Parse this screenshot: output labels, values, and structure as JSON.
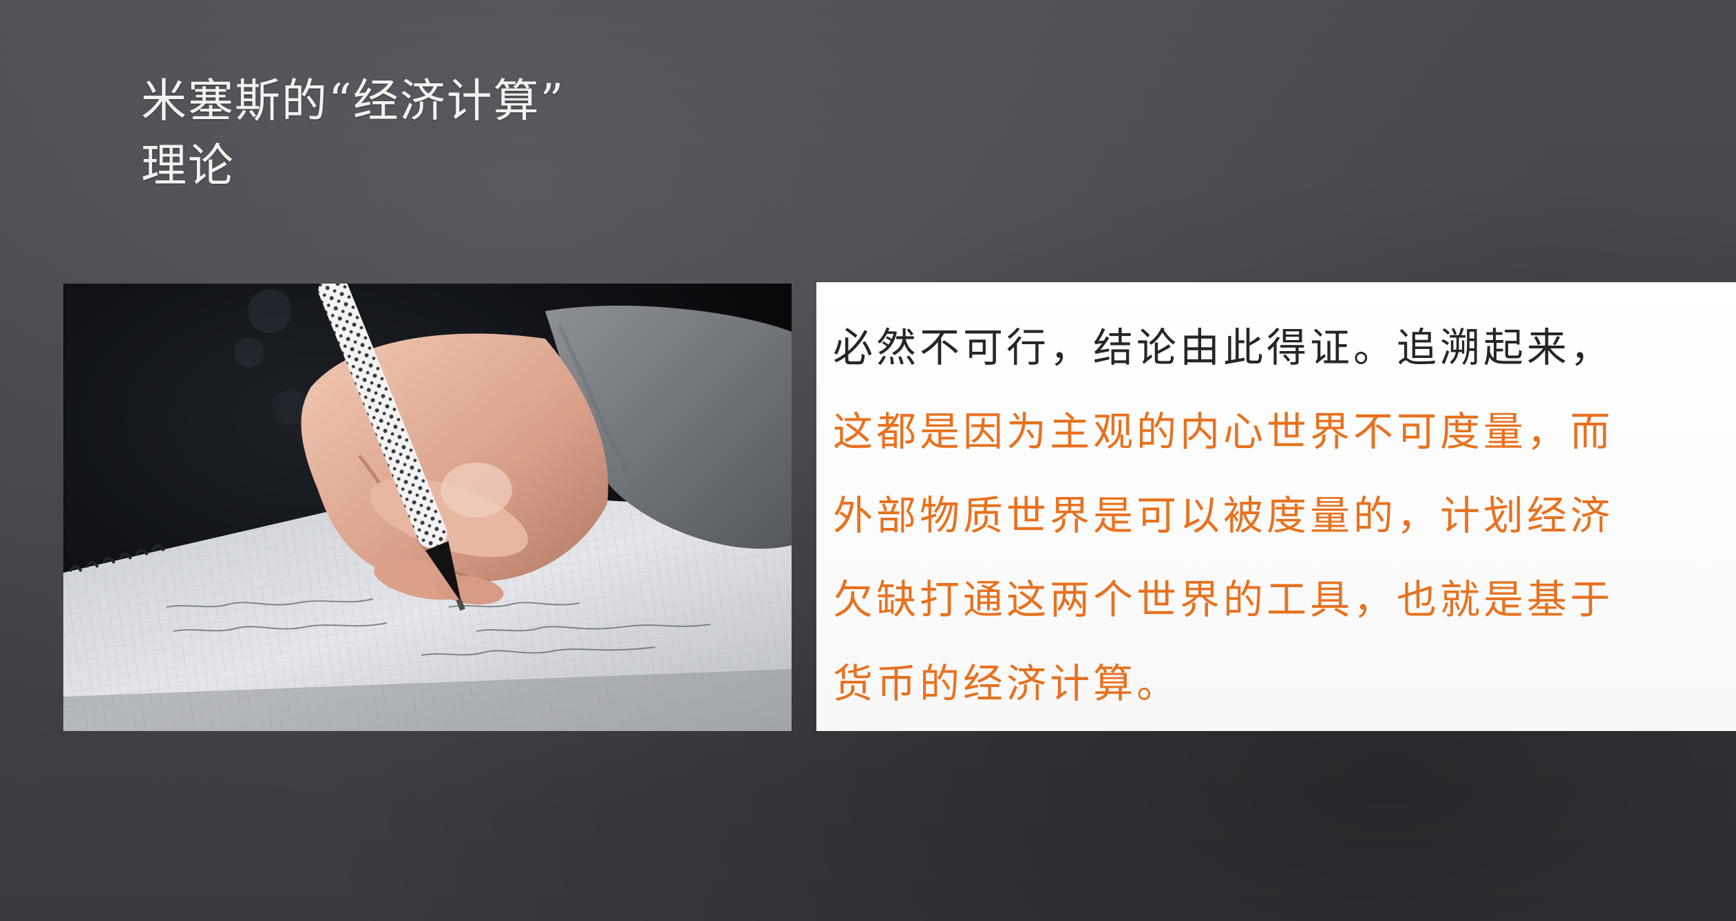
{
  "slide": {
    "title_line1": "米塞斯的“经济计算”",
    "title_line2": "理论"
  },
  "photo": {
    "subject": "hand-writing-with-pen-on-notebook"
  },
  "card": {
    "lines": [
      {
        "text": "必然不可行，结论由此得证。追溯起来，",
        "color": "#262626"
      },
      {
        "text": "这都是因为主观的内心世界不可度量，而",
        "color": "#e8711f"
      },
      {
        "text": "外部物质世界是可以被度量的，计划经济",
        "color": "#e8711f"
      },
      {
        "text": "欠缺打通这两个世界的工具，也就是基于",
        "color": "#e8711f"
      },
      {
        "text": "货币的经济计算。",
        "color": "#e8711f"
      }
    ]
  },
  "colors": {
    "background": "#434449",
    "title_text": "#f2f2f2",
    "body_text": "#262626",
    "highlight_text": "#e8711f",
    "card_background": "#ffffff"
  }
}
